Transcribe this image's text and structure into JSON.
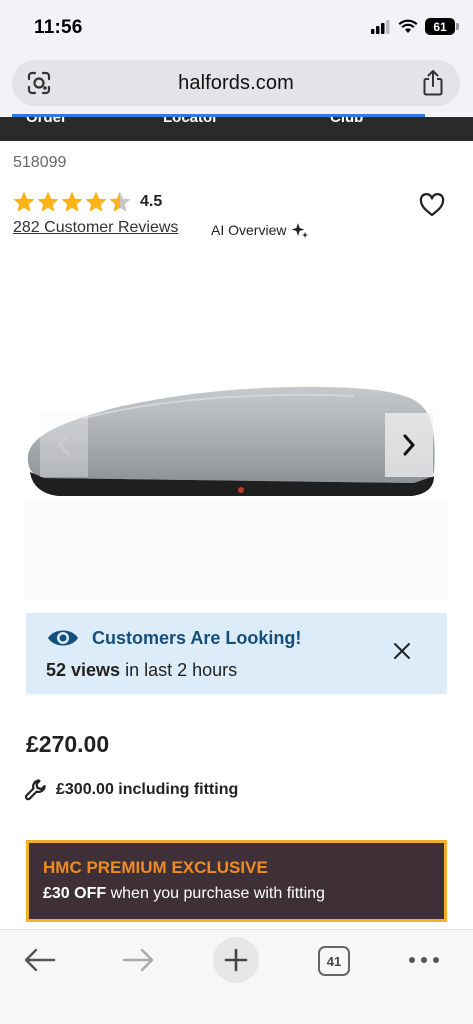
{
  "status_bar": {
    "time": "11:56",
    "battery": "61"
  },
  "browser": {
    "url": "halfords.com"
  },
  "site_nav": {
    "items": [
      "Order",
      "Locator",
      "Club"
    ]
  },
  "product": {
    "sku": "518099",
    "rating": "4.5",
    "rating_value": 4.5,
    "rating_max": 5,
    "reviews_label": "282 Customer Reviews",
    "ai_overview_label": "AI Overview"
  },
  "looking_banner": {
    "title": "Customers Are Looking!",
    "views_count": "52 views",
    "views_suffix": " in last 2 hours"
  },
  "pricing": {
    "price": "£270.00",
    "fitting_price": "£300.00 including fitting"
  },
  "promo": {
    "title": "HMC PREMIUM EXCLUSIVE",
    "discount": "£30 OFF",
    "description": " when you purchase with fitting"
  },
  "toolbar": {
    "tab_count": "41"
  },
  "colors": {
    "star": "#f7b318",
    "banner_bg": "#dcedf9",
    "banner_title": "#164e7c",
    "promo_bg": "#3e3036",
    "promo_border": "#f0b028",
    "promo_title": "#f08a24",
    "link_blue": "#2b7be3"
  },
  "icons": [
    "lens-icon",
    "share-icon",
    "heart-icon",
    "sparkle-icon",
    "eye-icon",
    "close-icon",
    "wrench-icon",
    "back-arrow-icon",
    "forward-arrow-icon",
    "plus-icon",
    "more-icon",
    "chevron-right-icon",
    "chevron-left-icon"
  ]
}
